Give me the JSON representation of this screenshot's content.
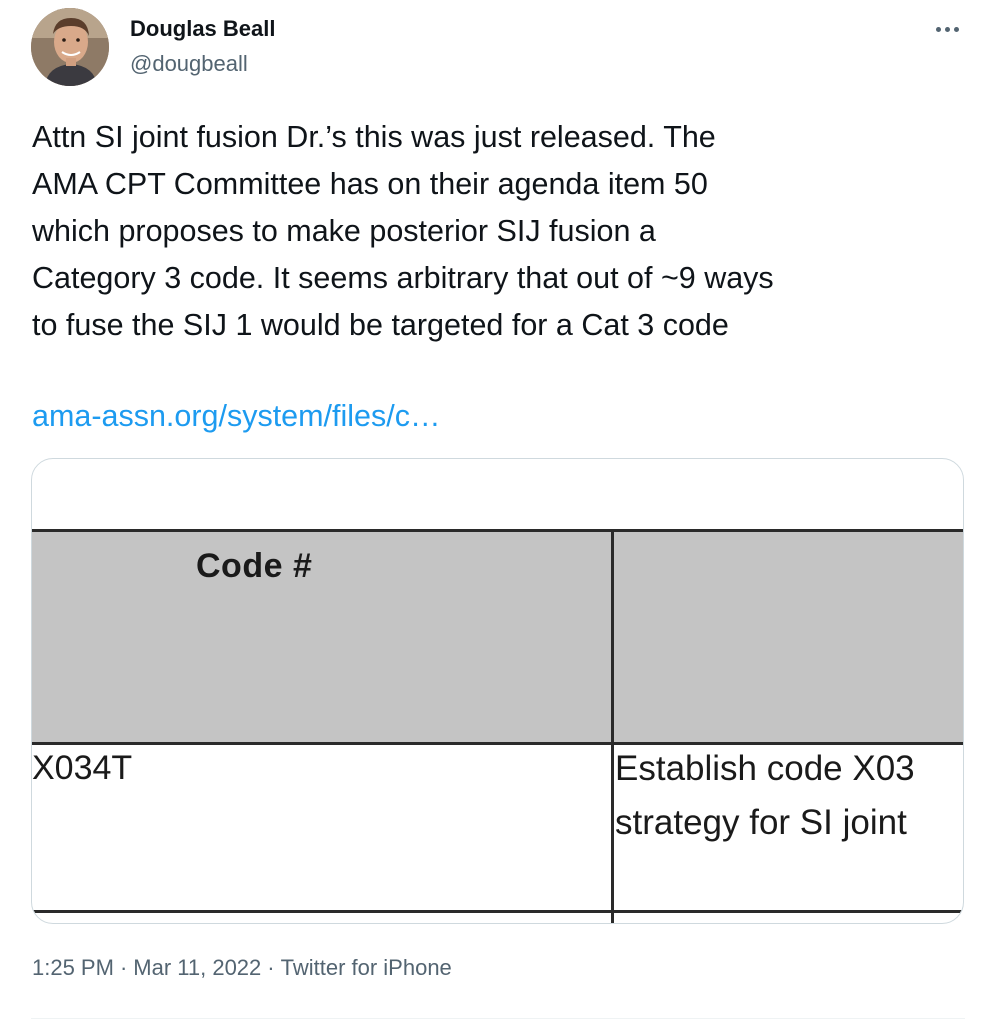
{
  "author": {
    "name": "Douglas Beall",
    "handle": "@dougbeall",
    "avatar_icon": "profile-photo"
  },
  "tweet": {
    "text_lines": [
      "Attn SI joint fusion Dr.’s this was just released. The",
      "AMA CPT Committee has on their agenda item 50",
      "which proposes to make posterior SIJ fusion a",
      "Category 3 code. It seems arbitrary that out of ~9 ways",
      "to fuse the SIJ 1 would be targeted for a Cat 3 code"
    ],
    "link_text": "ama-assn.org/system/files/c…",
    "link_color": "#1d9bf0"
  },
  "media": {
    "header_label": "Code #",
    "row1_code": "X034T",
    "row1_desc_line1": "Establish code X03",
    "row1_desc_line2": "strategy for SI joint"
  },
  "meta": {
    "time": "1:25 PM",
    "separator": "·",
    "date": "Mar 11, 2022",
    "source": "Twitter for iPhone"
  },
  "colors": {
    "text_primary": "#0f1419",
    "text_secondary": "#536471",
    "accent": "#1d9bf0",
    "table_header_bg": "#c4c4c4"
  }
}
